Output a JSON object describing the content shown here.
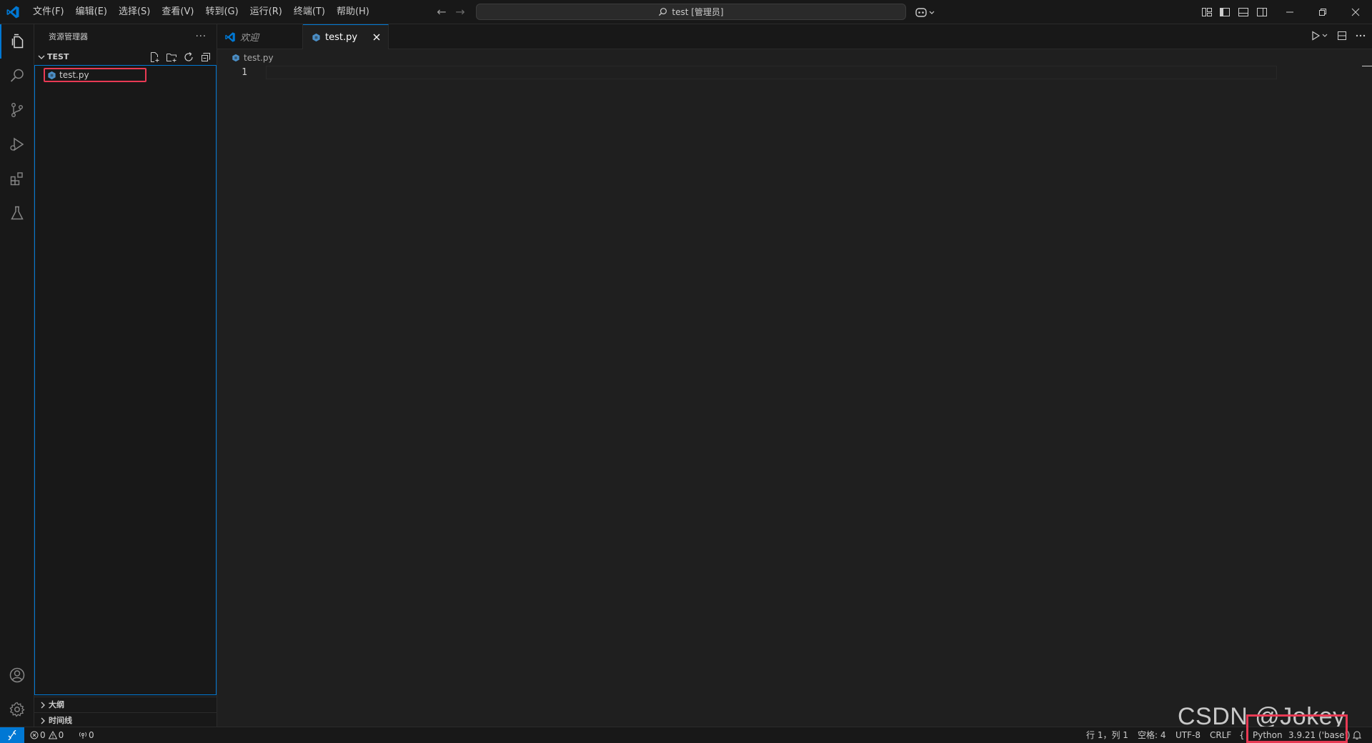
{
  "titlebar": {
    "menus": [
      "文件(F)",
      "编辑(E)",
      "选择(S)",
      "查看(V)",
      "转到(G)",
      "运行(R)",
      "终端(T)",
      "帮助(H)"
    ],
    "search_label": "test [管理员]"
  },
  "sidebar": {
    "title": "资源管理器",
    "more": "···",
    "folder_name": "TEST",
    "files": [
      "test.py"
    ],
    "sections": [
      "大纲",
      "时间线"
    ]
  },
  "tabs": [
    {
      "label": "欢迎",
      "active": false
    },
    {
      "label": "test.py",
      "active": true
    }
  ],
  "breadcrumb": {
    "file": "test.py"
  },
  "editor": {
    "line_numbers": [
      "1"
    ]
  },
  "watermark": "CSDN @Jokey",
  "statusbar": {
    "errors": "0",
    "warnings": "0",
    "ports": "0",
    "position": "行 1，列 1",
    "spaces": "空格: 4",
    "encoding": "UTF-8",
    "eol": "CRLF",
    "brace": "{",
    "language": "Python",
    "interpreter": "3.9.21 ('base')"
  },
  "colors": {
    "accent": "#0078d4",
    "highlight_box": "#e83a54",
    "python_icon": "#4b8fc7"
  }
}
